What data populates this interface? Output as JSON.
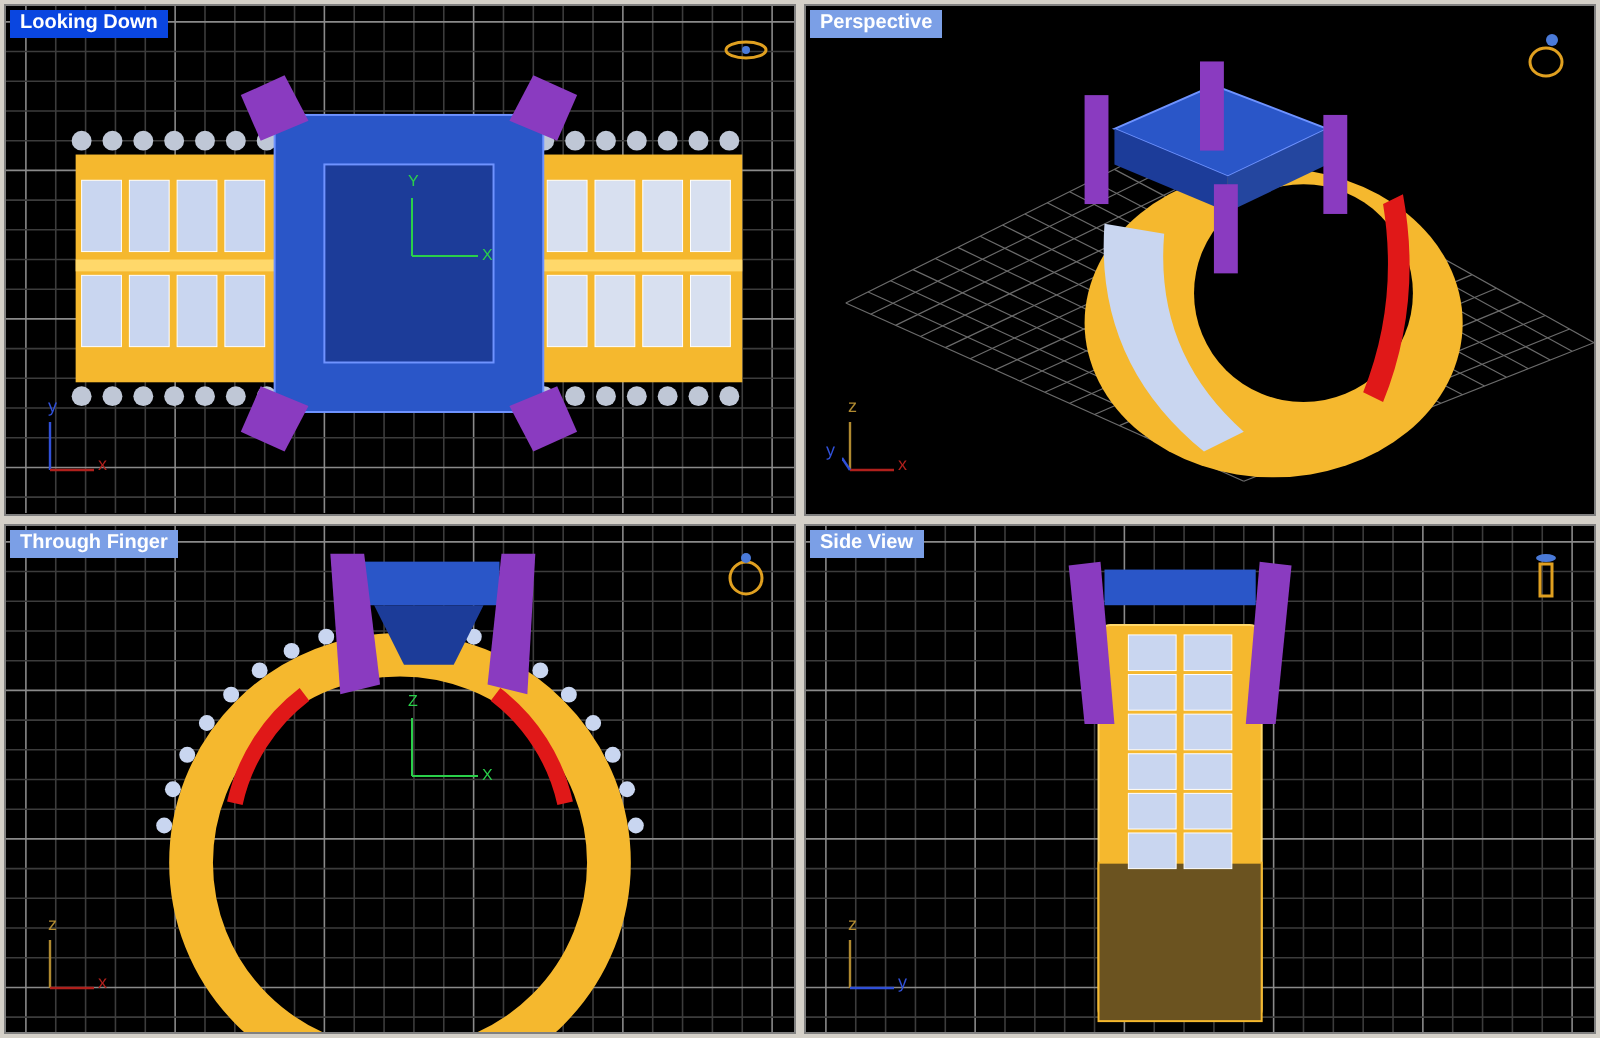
{
  "viewports": [
    {
      "title": "Looking Down",
      "selected": true,
      "kind": "top",
      "axes": [
        "y",
        "x"
      ],
      "center_axes": [
        "Y",
        "X"
      ]
    },
    {
      "title": "Perspective",
      "selected": false,
      "kind": "perspective",
      "axes": [
        "z",
        "y",
        "x"
      ]
    },
    {
      "title": "Through Finger",
      "selected": false,
      "kind": "front",
      "axes": [
        "z",
        "x"
      ],
      "center_axes": [
        "Z",
        "X"
      ]
    },
    {
      "title": "Side View",
      "selected": false,
      "kind": "side",
      "axes": [
        "z",
        "y"
      ]
    }
  ]
}
